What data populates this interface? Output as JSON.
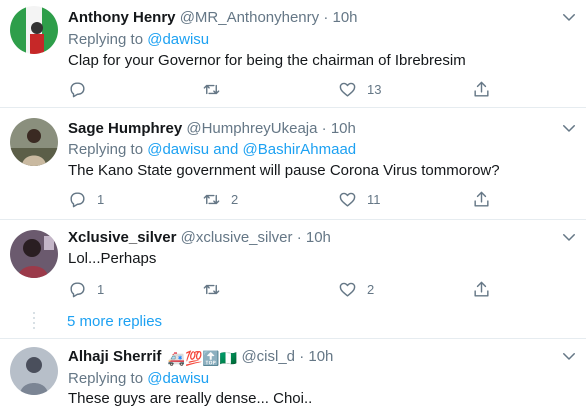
{
  "tweets": [
    {
      "name": "Anthony Henry",
      "handle": "@MR_Anthonyhenry",
      "dot": "·",
      "time": "10h",
      "replying_prefix": "Replying to ",
      "replying_to": "@dawisu",
      "replying_conj": "",
      "replying_to_2": "",
      "text": "Clap for your Governor for being the chairman of Ibrebresim",
      "counts": {
        "reply": "",
        "retweet": "",
        "like": "13"
      }
    },
    {
      "name": "Sage Humphrey",
      "handle": "@HumphreyUkeaja",
      "dot": "·",
      "time": "10h",
      "replying_prefix": "Replying to ",
      "replying_to": "@dawisu",
      "replying_conj": " and ",
      "replying_to_2": "@BashirAhmaad",
      "text": "The Kano State government will pause Corona Virus tommorow?",
      "counts": {
        "reply": "1",
        "retweet": "2",
        "like": "11"
      }
    },
    {
      "name": "Xclusive_silver",
      "handle": "@xclusive_silver",
      "dot": "·",
      "time": "10h",
      "text": "Lol...Perhaps",
      "counts": {
        "reply": "1",
        "retweet": "",
        "like": "2"
      }
    },
    {
      "name": "Alhaji Sherrif",
      "name_emojis": "🚑💯🔝🇳🇬",
      "handle": "@cisl_d",
      "dot": "·",
      "time": "10h",
      "replying_prefix": "Replying to ",
      "replying_to": "@dawisu",
      "text": "These guys are really dense... Choi.."
    }
  ],
  "more_replies": "5 more replies",
  "colors": {
    "link": "#1da1f2",
    "muted": "#657786",
    "border": "#e6ecf0",
    "text": "#14171a"
  },
  "icons": [
    "reply-icon",
    "retweet-icon",
    "like-icon",
    "share-icon",
    "chevron-down-icon"
  ]
}
